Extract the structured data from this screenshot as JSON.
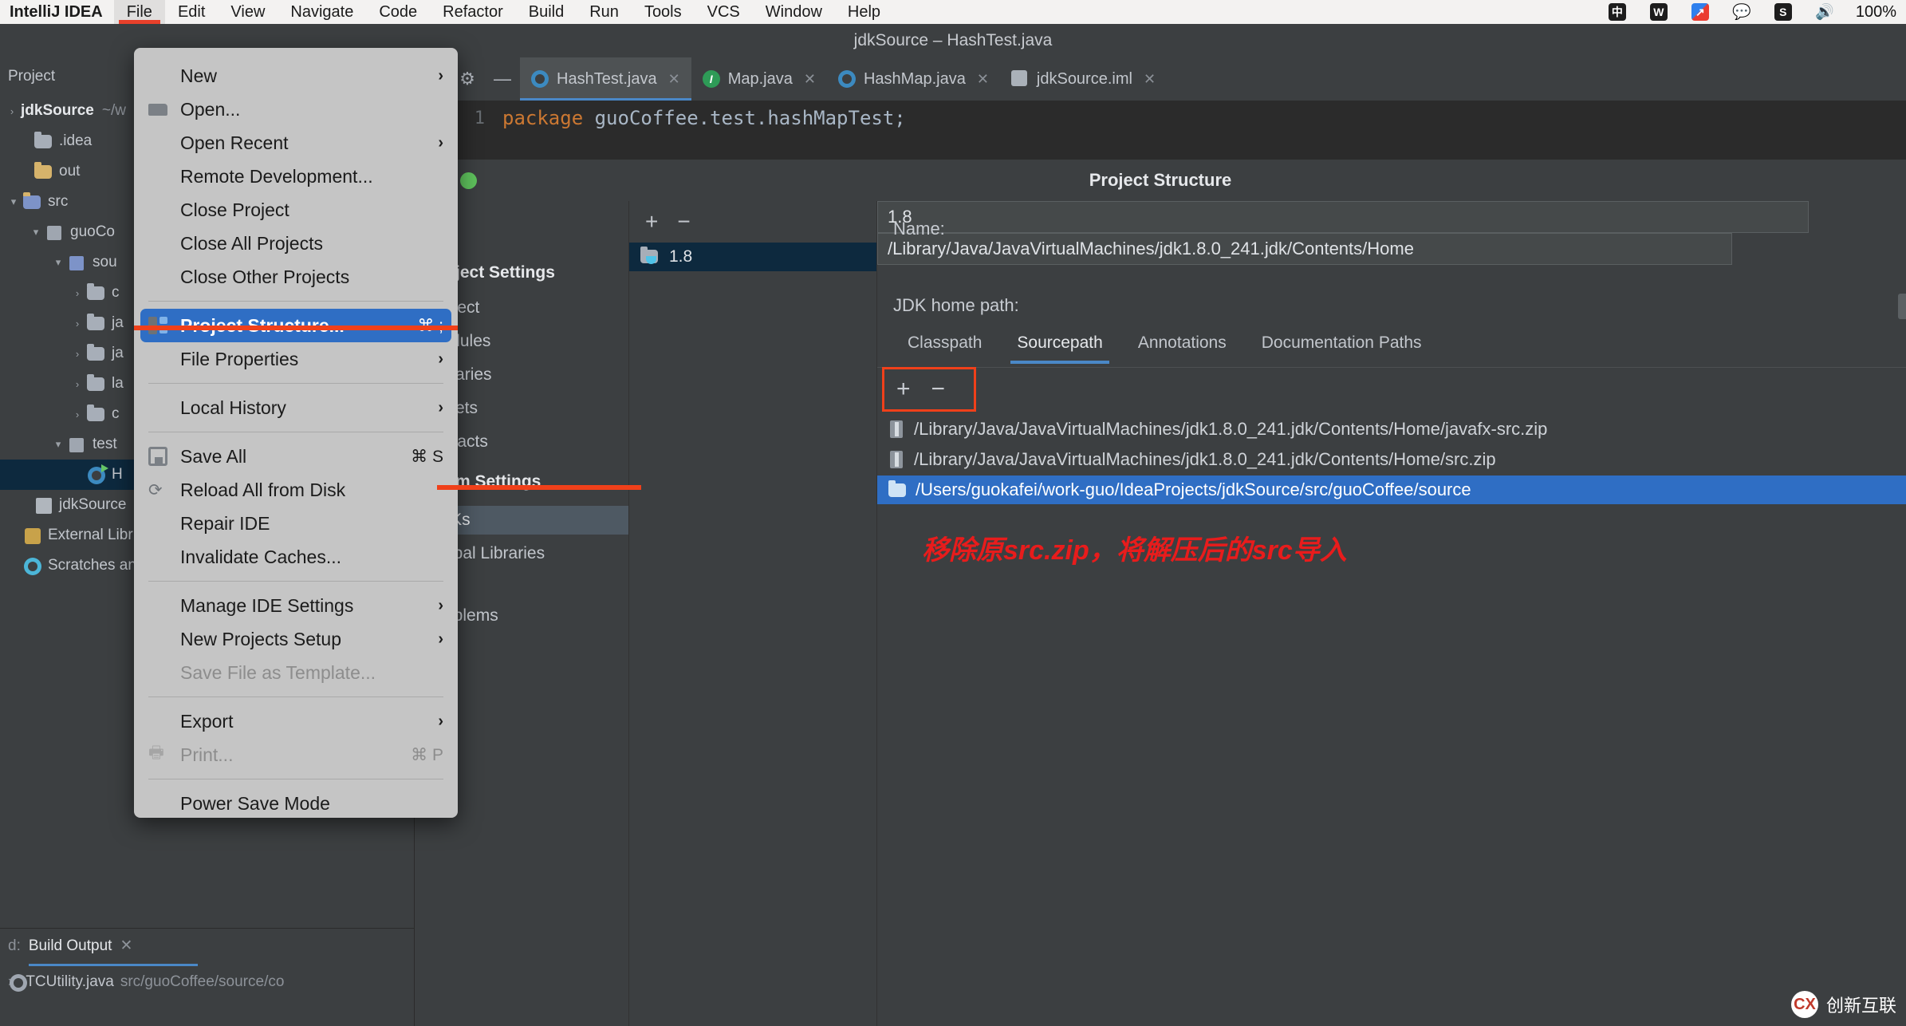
{
  "menubar": {
    "app": "IntelliJ IDEA",
    "items": [
      "File",
      "Edit",
      "View",
      "Navigate",
      "Code",
      "Refactor",
      "Build",
      "Run",
      "Tools",
      "VCS",
      "Window",
      "Help"
    ],
    "active": "File",
    "status_icons": [
      "input-method-icon",
      "wps-icon",
      "sync-icon",
      "wechat-icon",
      "sogou-icon",
      "volume-icon"
    ],
    "battery_percent": "100%"
  },
  "window": {
    "title": "jdkSource – HashTest.java"
  },
  "project_panel": {
    "header": "Project",
    "root": "jdkSource",
    "root_suffix": "~/w",
    "tree": [
      {
        "indent": 0,
        "arrow": "",
        "icon": "folder-grey",
        "label": ".idea"
      },
      {
        "indent": 0,
        "arrow": "",
        "icon": "folder-yellow",
        "label": "out"
      },
      {
        "indent": 0,
        "arrow": "▾",
        "icon": "folder-blue",
        "label": "src"
      },
      {
        "indent": 1,
        "arrow": "▾",
        "icon": "module-icon",
        "label": "guoCo"
      },
      {
        "indent": 2,
        "arrow": "▾",
        "icon": "source-icon",
        "label": "sou"
      },
      {
        "indent": 3,
        "arrow": "›",
        "icon": "folder-grey",
        "label": "c"
      },
      {
        "indent": 3,
        "arrow": "›",
        "icon": "folder-grey",
        "label": "ja"
      },
      {
        "indent": 3,
        "arrow": "›",
        "icon": "folder-grey",
        "label": "ja"
      },
      {
        "indent": 3,
        "arrow": "›",
        "icon": "folder-grey",
        "label": "la"
      },
      {
        "indent": 3,
        "arrow": "›",
        "icon": "folder-grey",
        "label": "c"
      },
      {
        "indent": 2,
        "arrow": "▾",
        "icon": "source-icon",
        "label": "test"
      },
      {
        "indent": 3,
        "arrow": "",
        "icon": "java-class-icon",
        "label": "H",
        "selected": true
      },
      {
        "indent": 0,
        "arrow": "",
        "icon": "xml-icon",
        "label": "jdkSource"
      },
      {
        "indent": 0,
        "arrow": "",
        "icon": "library-icon",
        "label": "External Libr"
      },
      {
        "indent": 0,
        "arrow": "",
        "icon": "scratch-icon",
        "label": "Scratches an"
      }
    ],
    "build_output": {
      "tab_label": "Build Output",
      "prefix": "d:",
      "row_label": "TCUtility.java",
      "row_path": "src/guoCoffee/source/co"
    }
  },
  "editor": {
    "tabs": [
      {
        "label": "HashTest.java",
        "icon": "java-class-icon",
        "active": true
      },
      {
        "label": "Map.java",
        "icon": "java-interface-icon",
        "active": false
      },
      {
        "label": "HashMap.java",
        "icon": "java-class-icon",
        "active": false
      },
      {
        "label": "jdkSource.iml",
        "icon": "xml-icon",
        "active": false
      }
    ],
    "toolbar_icons": [
      "back-arrow-icon",
      "settings-gear-icon",
      "minimize-icon"
    ],
    "line_number": "1",
    "code_keyword": "package",
    "code_rest": " guoCoffee.test.hashMapTest;"
  },
  "file_menu": {
    "items": [
      {
        "label": "New",
        "icon": "",
        "shortcut": "",
        "chevron": true,
        "selected": false,
        "disabled": false
      },
      {
        "label": "Open...",
        "icon": "folder-open-icon",
        "shortcut": "",
        "chevron": false,
        "selected": false,
        "disabled": false
      },
      {
        "label": "Open Recent",
        "icon": "",
        "shortcut": "",
        "chevron": true,
        "selected": false,
        "disabled": false
      },
      {
        "label": "Remote Development...",
        "icon": "",
        "shortcut": "",
        "chevron": false,
        "selected": false,
        "disabled": false
      },
      {
        "label": "Close Project",
        "icon": "",
        "shortcut": "",
        "chevron": false,
        "selected": false,
        "disabled": false
      },
      {
        "label": "Close All Projects",
        "icon": "",
        "shortcut": "",
        "chevron": false,
        "selected": false,
        "disabled": false
      },
      {
        "label": "Close Other Projects",
        "icon": "",
        "shortcut": "",
        "chevron": false,
        "selected": false,
        "disabled": false
      },
      {
        "separator": true
      },
      {
        "label": "Project Structure...",
        "icon": "project-structure-icon",
        "shortcut": "⌘ ;",
        "chevron": false,
        "selected": true,
        "disabled": false
      },
      {
        "label": "File Properties",
        "icon": "",
        "shortcut": "",
        "chevron": true,
        "selected": false,
        "disabled": false
      },
      {
        "separator": true
      },
      {
        "label": "Local History",
        "icon": "",
        "shortcut": "",
        "chevron": true,
        "selected": false,
        "disabled": false
      },
      {
        "separator": true
      },
      {
        "label": "Save All",
        "icon": "save-icon",
        "shortcut": "⌘ S",
        "chevron": false,
        "selected": false,
        "disabled": false
      },
      {
        "label": "Reload All from Disk",
        "icon": "reload-icon",
        "shortcut": "",
        "chevron": false,
        "selected": false,
        "disabled": false
      },
      {
        "label": "Repair IDE",
        "icon": "",
        "shortcut": "",
        "chevron": false,
        "selected": false,
        "disabled": false
      },
      {
        "label": "Invalidate Caches...",
        "icon": "",
        "shortcut": "",
        "chevron": false,
        "selected": false,
        "disabled": false
      },
      {
        "separator": true
      },
      {
        "label": "Manage IDE Settings",
        "icon": "",
        "shortcut": "",
        "chevron": true,
        "selected": false,
        "disabled": false
      },
      {
        "label": "New Projects Setup",
        "icon": "",
        "shortcut": "",
        "chevron": true,
        "selected": false,
        "disabled": false
      },
      {
        "label": "Save File as Template...",
        "icon": "",
        "shortcut": "",
        "chevron": false,
        "selected": false,
        "disabled": true
      },
      {
        "separator": true
      },
      {
        "label": "Export",
        "icon": "",
        "shortcut": "",
        "chevron": true,
        "selected": false,
        "disabled": false
      },
      {
        "label": "Print...",
        "icon": "print-icon",
        "shortcut": "⌘ P",
        "chevron": false,
        "selected": false,
        "disabled": true
      },
      {
        "separator": true
      },
      {
        "label": "Power Save Mode",
        "icon": "",
        "shortcut": "",
        "chevron": false,
        "selected": false,
        "disabled": false
      }
    ]
  },
  "project_structure": {
    "title": "Project Structure",
    "sidebar": {
      "project_settings_header": "Project Settings",
      "project_settings": [
        "Project",
        "Modules",
        "Libraries",
        "Facets",
        "Artifacts"
      ],
      "platform_settings_header": "tform Settings",
      "platform_settings": [
        "SDKs",
        "Global Libraries"
      ],
      "selected": "SDKs",
      "other": "Problems"
    },
    "sdk_list": {
      "add_label": "+",
      "remove_label": "−",
      "items": [
        {
          "label": "1.8",
          "selected": true
        }
      ]
    },
    "detail": {
      "name_label": "Name:",
      "name_value": "1.8",
      "jdk_home_label": "JDK home path:",
      "jdk_home_value": "/Library/Java/JavaVirtualMachines/jdk1.8.0_241.jdk/Contents/Home",
      "tabs": [
        "Classpath",
        "Sourcepath",
        "Annotations",
        "Documentation Paths"
      ],
      "active_tab": "Sourcepath",
      "toolbar": {
        "add": "+",
        "remove": "−"
      },
      "paths": [
        {
          "icon": "zip-icon",
          "label": "/Library/Java/JavaVirtualMachines/jdk1.8.0_241.jdk/Contents/Home/javafx-src.zip",
          "selected": false
        },
        {
          "icon": "zip-icon",
          "label": "/Library/Java/JavaVirtualMachines/jdk1.8.0_241.jdk/Contents/Home/src.zip",
          "selected": false
        },
        {
          "icon": "folder-icon",
          "label": "/Users/guokafei/work-guo/IdeaProjects/jdkSource/src/guoCoffee/source",
          "selected": true
        }
      ]
    },
    "annotation": "移除原src.zip，将解压后的src导入"
  },
  "watermark": {
    "label": "创新互联",
    "mark": "CX"
  },
  "colors": {
    "accent_blue": "#2f6ec4",
    "annotation_red": "#e81c1c",
    "highlight_red": "#f0401a",
    "menu_bg": "#c5c5c5",
    "ide_bg": "#3c3f41"
  }
}
